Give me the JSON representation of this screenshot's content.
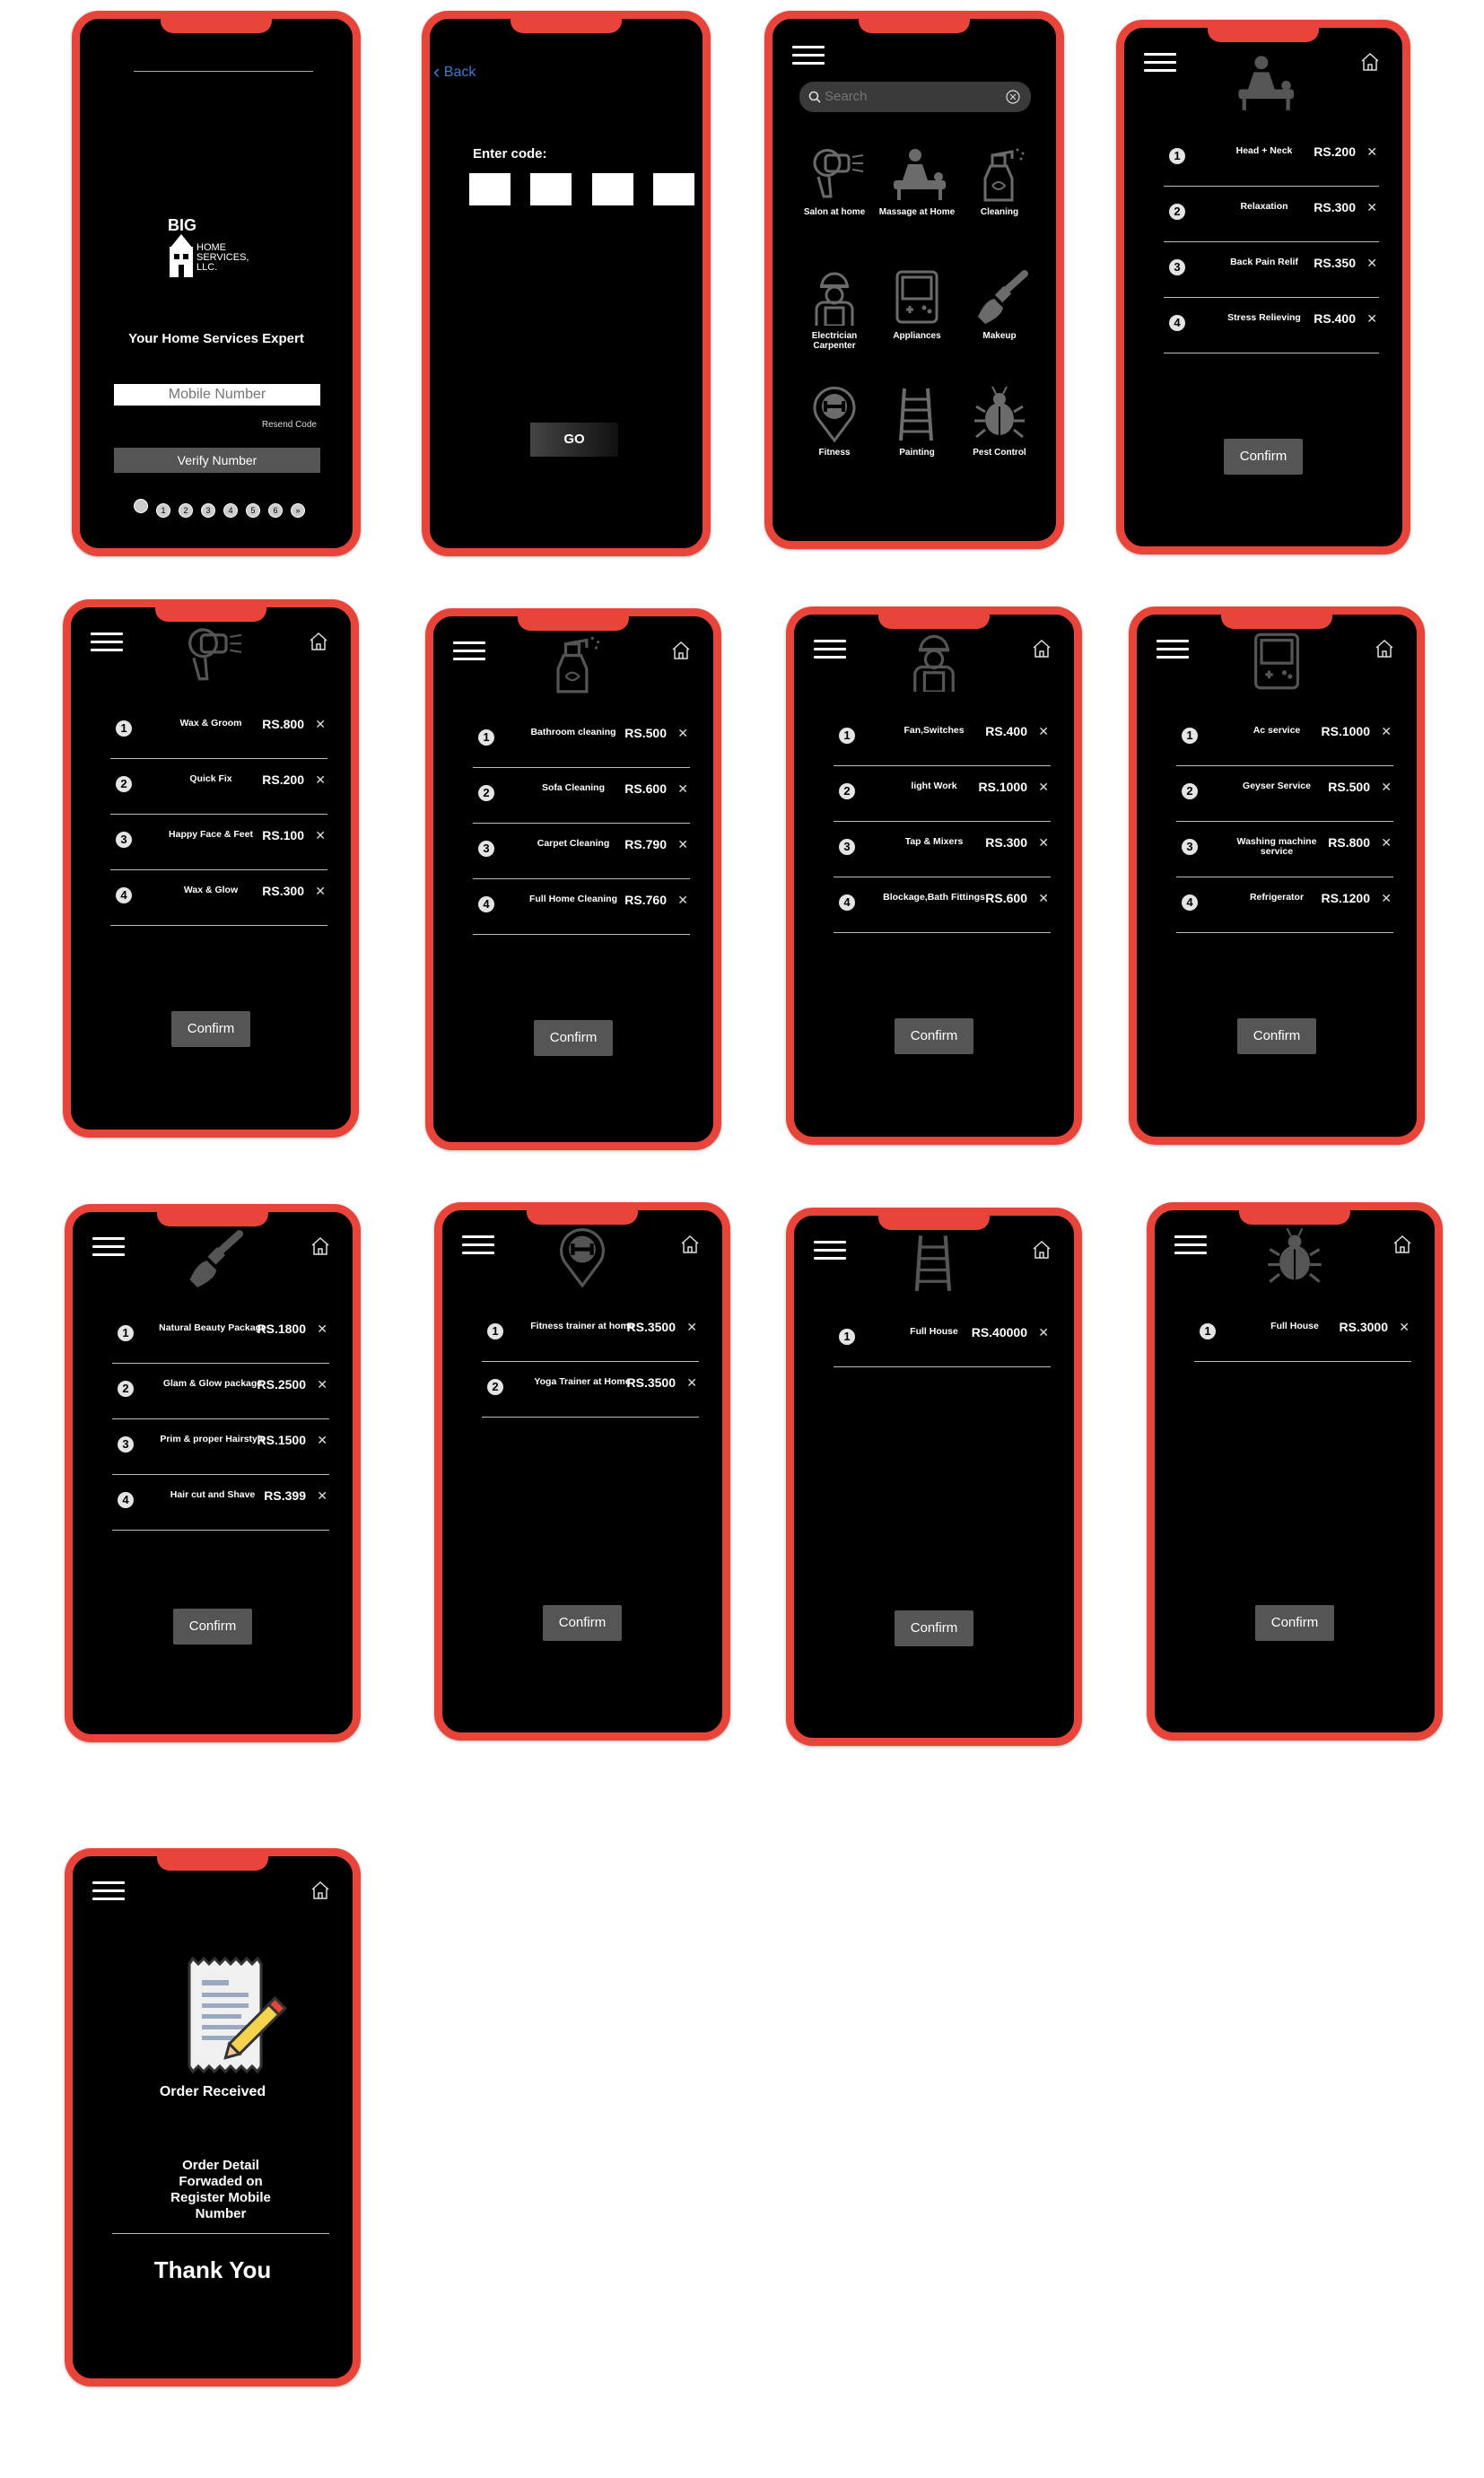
{
  "login": {
    "tagline": "Your Home Services Expert",
    "logo_big": "BIG",
    "logo_line1": "HOME",
    "logo_line2": "SERVICES,",
    "logo_line3": "LLC.",
    "mobile_placeholder": "Mobile Number",
    "resend": "Resend Code",
    "verify": "Verify Number",
    "dots": [
      "",
      "1",
      "2",
      "3",
      "4",
      "5",
      "6",
      "»"
    ]
  },
  "otp": {
    "back": "Back",
    "enter_code": "Enter code:",
    "go": "GO"
  },
  "home_grid": {
    "search_placeholder": "Search",
    "items": [
      {
        "label": "Salon at home",
        "icon": "hair-dryer-icon"
      },
      {
        "label": "Massage at Home",
        "icon": "massage-icon"
      },
      {
        "label": "Cleaning",
        "icon": "spray-bottle-icon"
      },
      {
        "label": "Electrician Carpenter",
        "icon": "worker-icon"
      },
      {
        "label": "Appliances",
        "icon": "appliance-icon"
      },
      {
        "label": "Makeup",
        "icon": "makeup-brush-icon"
      },
      {
        "label": "Fitness",
        "icon": "fitness-pin-icon"
      },
      {
        "label": "Painting",
        "icon": "ladder-icon"
      },
      {
        "label": "Pest Control",
        "icon": "bug-icon"
      }
    ]
  },
  "confirm_label": "Confirm",
  "massage": {
    "icon": "massage-icon",
    "rows": [
      {
        "n": "1",
        "name": "Head + Neck",
        "price": "RS.200"
      },
      {
        "n": "2",
        "name": "Relaxation",
        "price": "RS.300"
      },
      {
        "n": "3",
        "name": "Back Pain Relif",
        "price": "RS.350"
      },
      {
        "n": "4",
        "name": "Stress Relieving",
        "price": "RS.400"
      }
    ]
  },
  "salon": {
    "icon": "hair-dryer-icon",
    "rows": [
      {
        "n": "1",
        "name": "Wax & Groom",
        "price": "RS.800"
      },
      {
        "n": "2",
        "name": "Quick Fix",
        "price": "RS.200"
      },
      {
        "n": "3",
        "name": "Happy Face & Feet",
        "price": "RS.100"
      },
      {
        "n": "4",
        "name": "Wax & Glow",
        "price": "RS.300"
      }
    ]
  },
  "cleaning": {
    "icon": "spray-bottle-icon",
    "rows": [
      {
        "n": "1",
        "name": "Bathroom cleaning",
        "price": "RS.500"
      },
      {
        "n": "2",
        "name": "Sofa Cleaning",
        "price": "RS.600"
      },
      {
        "n": "3",
        "name": "Carpet Cleaning",
        "price": "RS.790"
      },
      {
        "n": "4",
        "name": "Full Home Cleaning",
        "price": "RS.760"
      }
    ]
  },
  "electric": {
    "icon": "worker-icon",
    "rows": [
      {
        "n": "1",
        "name": "Fan,Switches",
        "price": "RS.400"
      },
      {
        "n": "2",
        "name": "light Work",
        "price": "RS.1000"
      },
      {
        "n": "3",
        "name": "Tap & Mixers",
        "price": "RS.300"
      },
      {
        "n": "4",
        "name": "Blockage,Bath Fittings",
        "price": "RS.600"
      }
    ]
  },
  "appliances": {
    "icon": "appliance-icon",
    "rows": [
      {
        "n": "1",
        "name": "Ac service",
        "price": "RS.1000"
      },
      {
        "n": "2",
        "name": "Geyser Service",
        "price": "RS.500"
      },
      {
        "n": "3",
        "name": "Washing machine service",
        "price": "RS.800"
      },
      {
        "n": "4",
        "name": "Refrigerator",
        "price": "RS.1200"
      }
    ]
  },
  "makeup": {
    "icon": "makeup-brush-icon",
    "rows": [
      {
        "n": "1",
        "name": "Natural Beauty Package",
        "price": "RS.1800"
      },
      {
        "n": "2",
        "name": "Glam & Glow package",
        "price": "RS.2500"
      },
      {
        "n": "3",
        "name": "Prim & proper Hairstyle",
        "price": "RS.1500"
      },
      {
        "n": "4",
        "name": "Hair cut and Shave",
        "price": "RS.399"
      }
    ]
  },
  "fitness": {
    "icon": "fitness-pin-icon",
    "rows": [
      {
        "n": "1",
        "name": "Fitness trainer at home",
        "price": "RS.3500"
      },
      {
        "n": "2",
        "name": "Yoga Trainer at Home",
        "price": "RS.3500"
      }
    ]
  },
  "painting": {
    "icon": "ladder-icon",
    "rows": [
      {
        "n": "1",
        "name": "Full House",
        "price": "RS.40000"
      }
    ]
  },
  "pest": {
    "icon": "bug-icon",
    "rows": [
      {
        "n": "1",
        "name": "Full House",
        "price": "RS.3000"
      }
    ]
  },
  "order": {
    "received": "Order Received",
    "detail": "Order Detail Forwaded on Register Mobile Number",
    "thanks": "Thank You"
  }
}
